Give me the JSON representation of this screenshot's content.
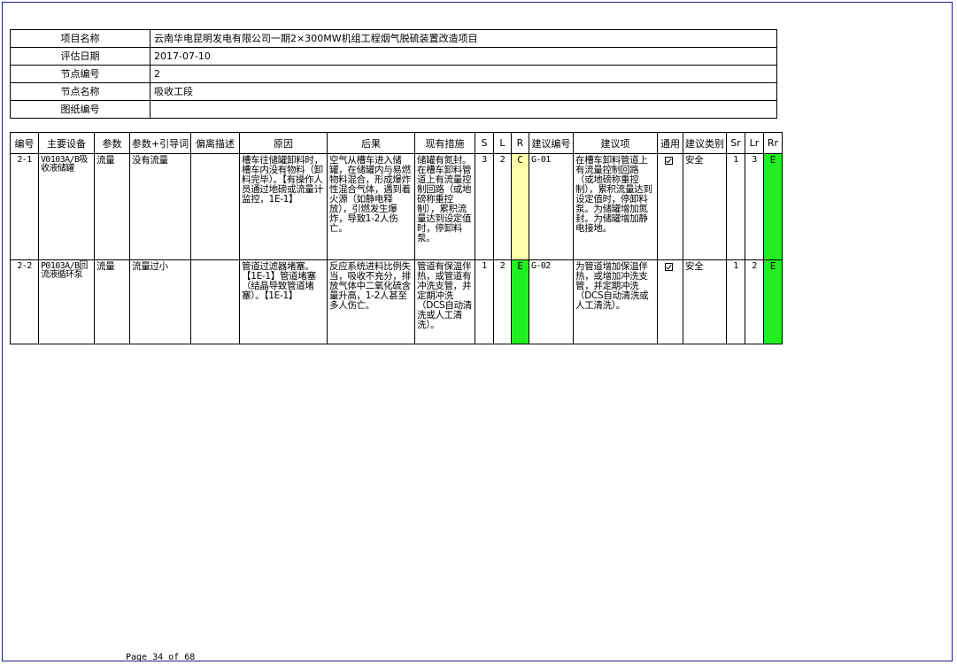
{
  "header": {
    "rows": [
      {
        "label": "项目名称",
        "value": "云南华电昆明发电有限公司一期2×300MW机组工程烟气脱硫装置改造项目"
      },
      {
        "label": "评估日期",
        "value": "2017-07-10"
      },
      {
        "label": "节点编号",
        "value": "2"
      },
      {
        "label": "节点名称",
        "value": "吸收工段"
      },
      {
        "label": "图纸编号",
        "value": ""
      }
    ]
  },
  "table": {
    "columns": [
      "编号",
      "主要设备",
      "参数",
      "参数+引导词",
      "偏离描述",
      "原因",
      "后果",
      "现有措施",
      "S",
      "L",
      "R",
      "建议编号",
      "建议项",
      "通用",
      "建议类别",
      "Sr",
      "Lr",
      "Rr"
    ],
    "rows": [
      {
        "id": "2-1",
        "equipment": "V0103A/B吸收液储罐",
        "parameter": "流量",
        "guideword": "没有流量",
        "deviation": "",
        "cause": "槽车往储罐卸料时，槽车内没有物料（卸料完毕）。【有操作人员通过地磅或流量计监控，1E-1】",
        "consequence": "空气从槽车进入储罐，在储罐内与易燃物料混合，形成爆炸性混合气体，遇到着火源（如静电释放），引燃发生爆炸，导致1-2人伤亡。",
        "safeguards": "储罐有氮封。在槽车卸料管道上有流量控制回路（或地磅称重控制），累积流量达到设定值时，停卸料泵。",
        "S": "3",
        "L": "2",
        "R": "C",
        "R_color": "#ffffaa",
        "rec_id": "G-01",
        "recommendation": "在槽车卸料管道上有流量控制回路（或地磅称重控制），累积流量达到设定值时，停卸料泵。为储罐增加氮封。为储罐增加静电接地。",
        "general": true,
        "category": "安全",
        "Sr": "1",
        "Lr": "3",
        "Rr": "E",
        "Rr_color": "#22ee22"
      },
      {
        "id": "2-2",
        "equipment": "P0103A/B回流液循环泵",
        "parameter": "流量",
        "guideword": "流量过小",
        "deviation": "",
        "cause": "管道过滤器堵塞。【1E-1】管道堵塞（结晶导致管道堵塞）。【1E-1】",
        "consequence": "反应系统进料比例失当，吸收不充分，排放气体中二氧化硫含量升高，1-2人甚至多人伤亡。",
        "safeguards": "管道有保温伴热，或管道有冲洗支管，并定期冲洗（DCS自动清洗或人工清洗）。",
        "S": "1",
        "L": "2",
        "R": "E",
        "R_color": "#22ee22",
        "rec_id": "G-02",
        "recommendation": "为管道增加保温伴热，或增加冲洗支管，并定期冲洗（DCS自动清洗或人工清洗）。",
        "general": true,
        "category": "安全",
        "Sr": "1",
        "Lr": "2",
        "Rr": "E",
        "Rr_color": "#22ee22"
      }
    ]
  },
  "footer": {
    "page": "Page 34 of 68"
  }
}
